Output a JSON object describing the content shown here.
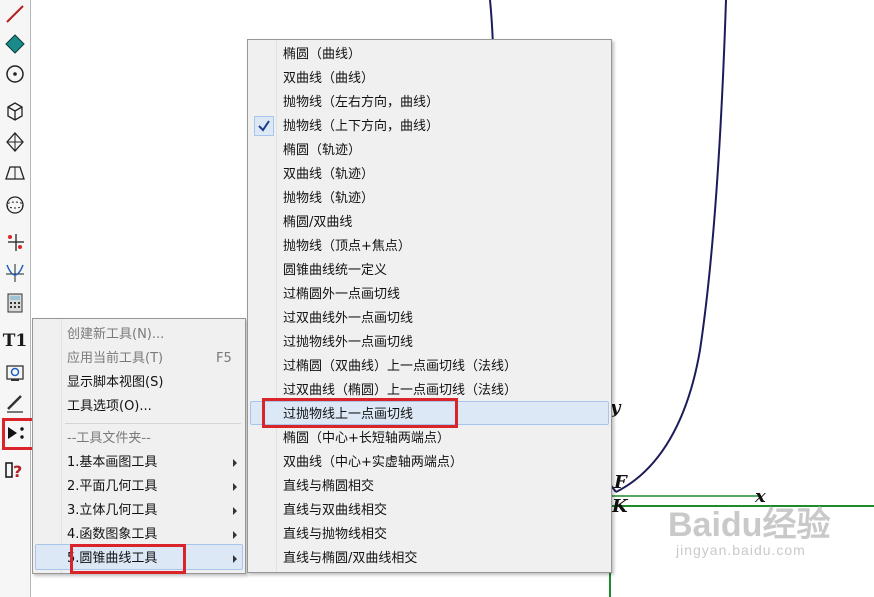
{
  "tool_menu": {
    "items": [
      {
        "label": "创建新工具(N)...",
        "enabled": false
      },
      {
        "label": "应用当前工具(T)",
        "shortcut": "F5",
        "enabled": false
      },
      {
        "label": "显示脚本视图(S)",
        "enabled": true
      },
      {
        "label": "工具选项(O)...",
        "enabled": true
      }
    ],
    "folder_header": "--工具文件夹--",
    "folders": [
      {
        "label": "1.基本画图工具"
      },
      {
        "label": "2.平面几何工具"
      },
      {
        "label": "3.立体几何工具"
      },
      {
        "label": "4.函数图象工具"
      },
      {
        "label": "5.圆锥曲线工具",
        "highlighted": true
      }
    ]
  },
  "conic_menu": {
    "checked_index": 3,
    "highlighted_index": 15,
    "items": [
      "椭圆（曲线）",
      "双曲线（曲线）",
      "抛物线（左右方向，曲线）",
      "抛物线（上下方向，曲线）",
      "椭圆（轨迹）",
      "双曲线（轨迹）",
      "抛物线（轨迹）",
      "椭圆/双曲线",
      "抛物线（顶点+焦点）",
      "圆锥曲线统一定义",
      "过椭圆外一点画切线",
      "过双曲线外一点画切线",
      "过抛物线外一点画切线",
      "过椭圆（双曲线）上一点画切线（法线）",
      "过双曲线（椭圆）上一点画切线（法线）",
      "过抛物线上一点画切线",
      "椭圆（中心+长短轴两端点）",
      "双曲线（中心+实虚轴两端点）",
      "直线与椭圆相交",
      "直线与双曲线相交",
      "直线与抛物线相交",
      "直线与椭圆/双曲线相交"
    ]
  },
  "canvas": {
    "labels": {
      "y_axis": "y",
      "x_axis": "x",
      "focus": "F",
      "point": "K"
    }
  },
  "toolbar": {
    "tools": [
      "line-tool-icon",
      "point-tool-icon",
      "circle-tool-icon",
      "cube-tool-icon",
      "octahedron-tool-icon",
      "prism-tool-icon",
      "sphere-tool-icon",
      "coordinate-tool-icon",
      "function-tool-icon",
      "calculator-icon",
      "text-tool-icon",
      "media-tool-icon",
      "pen-tool-icon",
      "custom-tool-icon",
      "help-icon"
    ],
    "text_tool_label": "T1",
    "help_label": "?"
  },
  "watermark": {
    "main": "Baidu经验",
    "sub": "jingyan.baidu.com"
  },
  "colors": {
    "highlight_box": "#d9252a",
    "curve": "#1c1c5a",
    "axis": "#1f8a2a",
    "menu_hover": "#dce8f6"
  }
}
